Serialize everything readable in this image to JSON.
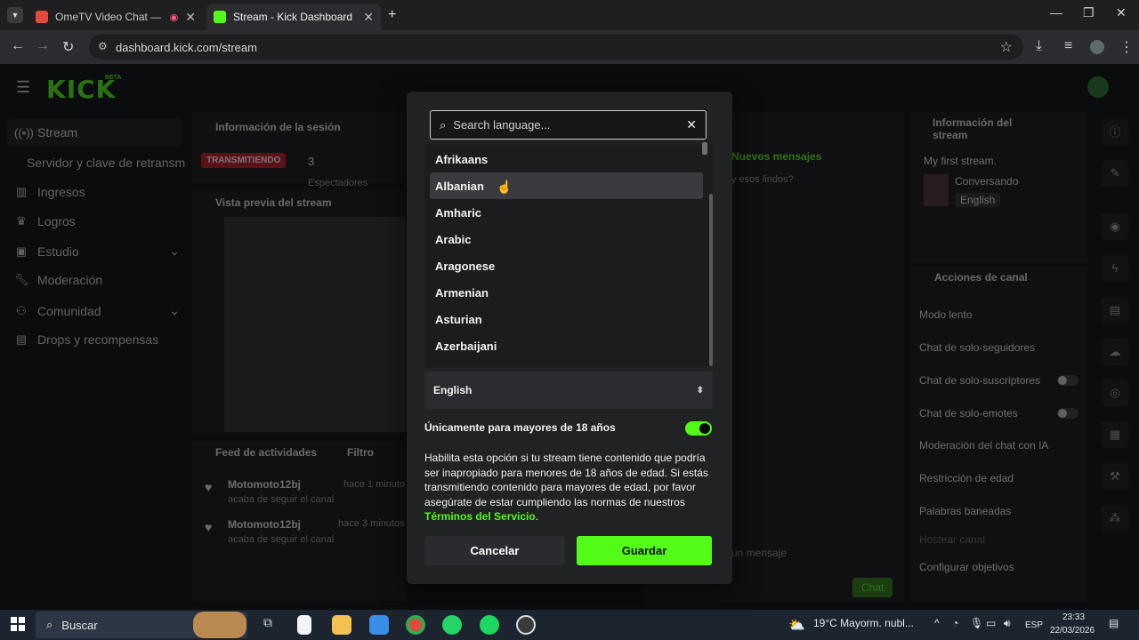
{
  "browser": {
    "tabs": [
      {
        "title": "OmeTV Video Chat — Om",
        "active": false
      },
      {
        "title": "Stream - Kick Dashboard",
        "active": true
      }
    ],
    "url": "dashboard.kick.com/stream"
  },
  "app": {
    "logo": "KICK",
    "beta": "BETA",
    "nav": [
      {
        "label": "Stream",
        "icon": "broadcast-icon"
      },
      {
        "label": "Servidor y clave de retransm",
        "icon": ""
      },
      {
        "label": "Ingresos",
        "icon": "bank-icon"
      },
      {
        "label": "Logros",
        "icon": "trophy-icon"
      },
      {
        "label": "Estudio",
        "icon": "studio-icon"
      },
      {
        "label": "Moderación",
        "icon": "wrench-icon"
      },
      {
        "label": "Comunidad",
        "icon": "people-icon"
      },
      {
        "label": "Drops y recompensas",
        "icon": "chart-icon"
      }
    ],
    "session": {
      "title": "Información de la sesión",
      "status": "TRANSMITIENDO",
      "viewers": "3",
      "partial": "Espectadores"
    },
    "preview": {
      "title": "Vista previa del stream"
    },
    "feed": {
      "title": "Feed de actividades",
      "filter": "Filtro",
      "items": [
        {
          "user": "Motomoto12bj",
          "text": "acaba de seguir el canal",
          "time": "hace 1 minuto"
        },
        {
          "user": "Motomoto12bj",
          "text": "acaba de seguir el canal",
          "time": "hace 3 minutos"
        }
      ]
    },
    "chat": {
      "new_messages": "Nuevos mensajes",
      "message": "y esos lindos?",
      "input_placeholder": "un mensaje",
      "send": "Chat"
    },
    "channel_info": {
      "title": "Información del stream",
      "stream_title": "My first stream.",
      "category": "Conversando",
      "language": "English"
    },
    "channel_actions": {
      "title": "Acciones de canal",
      "items": [
        "Modo lento",
        "Chat de solo-seguidores",
        "Chat de solo-suscriptores",
        "Chat de solo-emotes",
        "Moderación del chat con IA",
        "Restricción de edad",
        "Palabras baneadas",
        "Hostear canal",
        "Configurar objetivos"
      ]
    }
  },
  "modal": {
    "search_placeholder": "Search language...",
    "languages": [
      "Afrikaans",
      "Albanian",
      "Amharic",
      "Arabic",
      "Aragonese",
      "Armenian",
      "Asturian",
      "Azerbaijani"
    ],
    "hovered": "Albanian",
    "selected_language": "English",
    "adult_label": "Únicamente para mayores de 18 años",
    "adult_enabled": true,
    "description": "Habilita esta opción si tu stream tiene contenido que podría ser inapropiado para menores de 18 años de edad. Si estás transmitiendo contenido para mayores de edad, por favor asegúrate de estar cumpliendo las normas de nuestros",
    "terms_link": "Términos del Servicio",
    "cancel": "Cancelar",
    "save": "Guardar"
  },
  "taskbar": {
    "search": "Buscar",
    "weather": "19°C  Mayorm. nubl...",
    "lang": "ESP",
    "time": "23:33",
    "date": "22/03/2026"
  },
  "colors": {
    "accent": "#53fc18",
    "live": "#c0161d"
  }
}
